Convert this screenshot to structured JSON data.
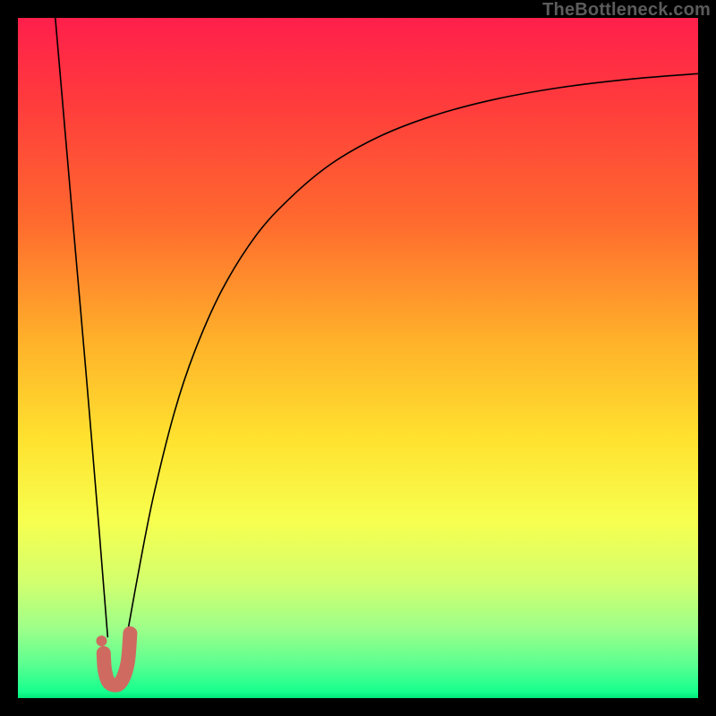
{
  "watermark": "TheBottleneck.com",
  "chart_data": {
    "type": "line",
    "title": "",
    "xlabel": "",
    "ylabel": "",
    "xlim": [
      0,
      100
    ],
    "ylim": [
      0,
      100
    ],
    "grid": false,
    "legend": false,
    "notes": "Two curves descending to a common minimum near x≈14 then diverging. Left curve is steep/linear from top-left frame edge down to the minimum. Right curve rises from the minimum and asymptotically approaches ~y≈92 at the right edge. A short thick salmon-colored J-shaped stroke sits at the bottom of the valley.",
    "series": [
      {
        "name": "left-branch",
        "x": [
          5.5,
          8,
          10,
          12,
          13.2
        ],
        "y": [
          100,
          71,
          48,
          24,
          9
        ],
        "stroke": "#000000",
        "width": 1.6
      },
      {
        "name": "right-branch",
        "x": [
          16,
          18,
          20,
          23,
          26,
          30,
          35,
          40,
          46,
          53,
          61,
          70,
          80,
          90,
          100
        ],
        "y": [
          9,
          20,
          30,
          42,
          51,
          60,
          68,
          73.5,
          78.5,
          82.5,
          85.6,
          88,
          89.8,
          91,
          91.8
        ],
        "stroke": "#000000",
        "width": 1.6
      },
      {
        "name": "valley-marker",
        "x": [
          12.6,
          12.8,
          13.5,
          15,
          16.1,
          16.5
        ],
        "y": [
          6.6,
          4,
          2.2,
          2.2,
          5,
          9.5
        ],
        "stroke": "#cf6a61",
        "width": 16
      },
      {
        "name": "valley-dot",
        "x": [
          12.3
        ],
        "y": [
          8.4
        ],
        "stroke": "#cf6a61",
        "width": 12
      }
    ],
    "gradient_stops": [
      {
        "pos": 0.0,
        "color": "#ff1f4b"
      },
      {
        "pos": 0.12,
        "color": "#ff3a3d"
      },
      {
        "pos": 0.3,
        "color": "#ff6a2e"
      },
      {
        "pos": 0.48,
        "color": "#ffb32a"
      },
      {
        "pos": 0.62,
        "color": "#ffe22f"
      },
      {
        "pos": 0.74,
        "color": "#f7ff4f"
      },
      {
        "pos": 0.83,
        "color": "#d2ff6e"
      },
      {
        "pos": 0.9,
        "color": "#9bff8a"
      },
      {
        "pos": 0.95,
        "color": "#5cff90"
      },
      {
        "pos": 0.99,
        "color": "#17ff8e"
      },
      {
        "pos": 1.0,
        "color": "#00e878"
      }
    ]
  }
}
